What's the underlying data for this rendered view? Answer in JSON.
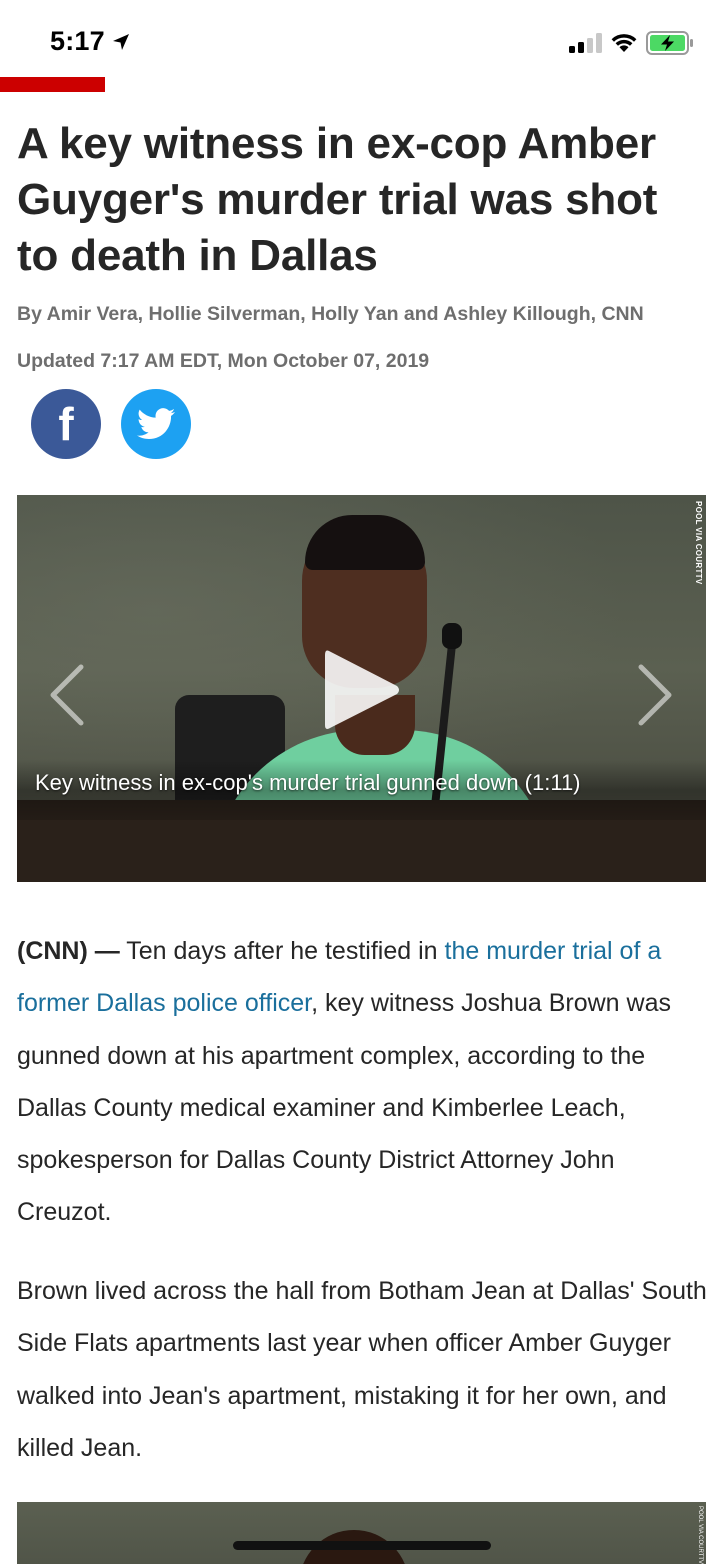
{
  "status_bar": {
    "time": "5:17"
  },
  "article": {
    "headline": "A key witness in ex-cop Amber Guyger's murder trial was shot to death in Dallas",
    "byline": "By Amir Vera, Hollie Silverman, Holly Yan and Ashley Killough, CNN",
    "updated": "Updated 7:17 AM EDT, Mon October 07, 2019"
  },
  "share": {
    "facebook_glyph": "f",
    "facebook_icon": "facebook-icon",
    "twitter_icon": "twitter-icon"
  },
  "video": {
    "caption": "Key witness in ex-cop's murder trial gunned down (1:11)",
    "credit": "POOL VIA COURTTV"
  },
  "body": {
    "p1_dateline": "(CNN) —",
    "p1_before_link": " Ten days after he testified in ",
    "p1_link": "the murder trial of a former Dallas police officer",
    "p1_after_link": ", key witness Joshua Brown was gunned down at his apartment complex, according to the Dallas County medical examiner and Kimberlee Leach, spokesperson for Dallas County District Attorney John Creuzot.",
    "p2": "Brown lived across the hall from Botham Jean at Dallas' South Side Flats apartments last year when officer Amber Guyger walked into Jean's apartment, mistaking it for her own, and killed Jean."
  },
  "colors": {
    "brand_red": "#cc0000",
    "link": "#1a6f9c",
    "facebook": "#3b5998",
    "twitter": "#1da1f2"
  }
}
